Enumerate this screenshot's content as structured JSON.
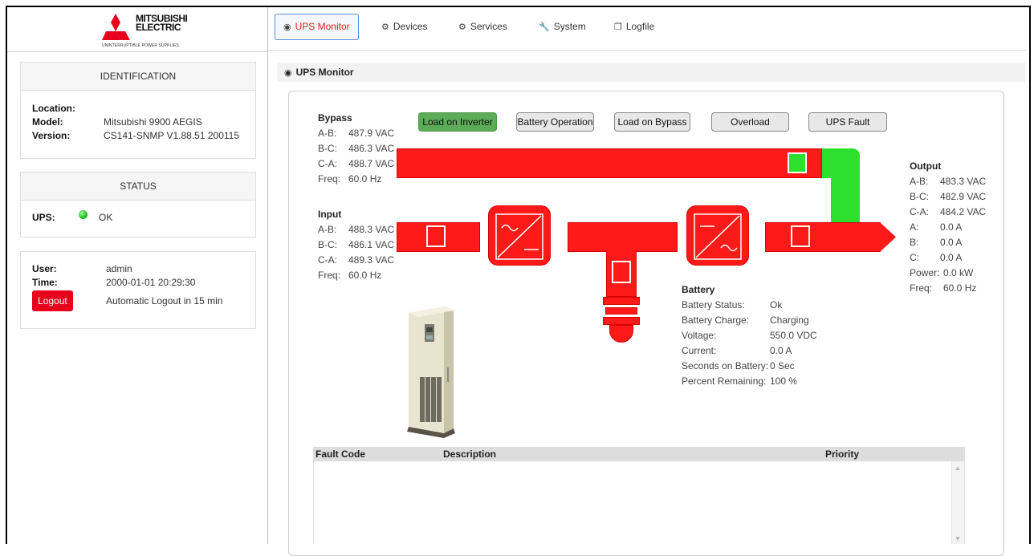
{
  "brand": {
    "line1": "MITSUBISHI",
    "line2": "ELECTRIC",
    "tagline": "UNINTERRUPTIBLE POWER SUPPLIES",
    "logo_color": "#e8001c"
  },
  "nav": {
    "tabs": [
      {
        "label": "UPS Monitor",
        "icon": "dashboard-icon",
        "active": true
      },
      {
        "label": "Devices",
        "icon": "gears-icon",
        "active": false
      },
      {
        "label": "Services",
        "icon": "gears-icon",
        "active": false
      },
      {
        "label": "System",
        "icon": "wrench-icon",
        "active": false
      },
      {
        "label": "Logfile",
        "icon": "copy-icon",
        "active": false
      }
    ]
  },
  "identification": {
    "title": "IDENTIFICATION",
    "location_label": "Location:",
    "location": "",
    "model_label": "Model:",
    "model": "Mitsubishi 9900 AEGIS",
    "version_label": "Version:",
    "version": "CS141-SNMP V1.88.51 200115"
  },
  "status": {
    "title": "STATUS",
    "ups_label": "UPS:",
    "ups_value": "OK",
    "led_color": "#22bb22"
  },
  "session": {
    "user_label": "User:",
    "user": "admin",
    "time_label": "Time:",
    "time": "2000-01-01 20:29:30",
    "logout_label": "Logout",
    "auto_logout": "Automatic Logout in 15 min"
  },
  "page_title": "UPS Monitor",
  "state_buttons": [
    {
      "label": "Load on Inverter",
      "active": true
    },
    {
      "label": "Battery Operation",
      "active": false
    },
    {
      "label": "Load on Bypass",
      "active": false
    },
    {
      "label": "Overload",
      "active": false
    },
    {
      "label": "UPS Fault",
      "active": false
    }
  ],
  "bypass": {
    "title": "Bypass",
    "ab_label": "A-B:",
    "ab": "487.9 VAC",
    "bc_label": "B-C:",
    "bc": "486.3 VAC",
    "ca_label": "C-A:",
    "ca": "488.7 VAC",
    "freq_label": "Freq:",
    "freq": "60.0 Hz"
  },
  "input": {
    "title": "Input",
    "ab_label": "A-B:",
    "ab": "488.3 VAC",
    "bc_label": "B-C:",
    "bc": "486.1 VAC",
    "ca_label": "C-A:",
    "ca": "489.3 VAC",
    "freq_label": "Freq:",
    "freq": "60.0 Hz"
  },
  "output": {
    "title": "Output",
    "ab_label": "A-B:",
    "ab": "483.3 VAC",
    "bc_label": "B-C:",
    "bc": "482.9 VAC",
    "ca_label": "C-A:",
    "ca": "484.2 VAC",
    "a_label": "A:",
    "a": "0.0 A",
    "b_label": "B:",
    "b": "0.0 A",
    "c_label": "C:",
    "c": "0.0 A",
    "power_label": "Power:",
    "power": "0.0 kW",
    "freq_label": "Freq:",
    "freq": "60.0 Hz"
  },
  "battery": {
    "title": "Battery",
    "status_label": "Battery Status:",
    "status": "Ok",
    "charge_label": "Battery Charge:",
    "charge": "Charging",
    "voltage_label": "Voltage:",
    "voltage": "550.0 VDC",
    "current_label": "Current:",
    "current": "0.0 A",
    "seconds_label": "Seconds on Battery:",
    "seconds": "0 Sec",
    "percent_label": "Percent Remaining:",
    "percent": "100 %"
  },
  "fault_table": {
    "col_code": "Fault Code",
    "col_desc": "Description",
    "col_priority": "Priority"
  },
  "colors": {
    "flow_active": "#ff1a1a",
    "flow_bypass": "#2ee02e",
    "state_on": "#5cab58",
    "tab_active_text": "#e0241b"
  }
}
